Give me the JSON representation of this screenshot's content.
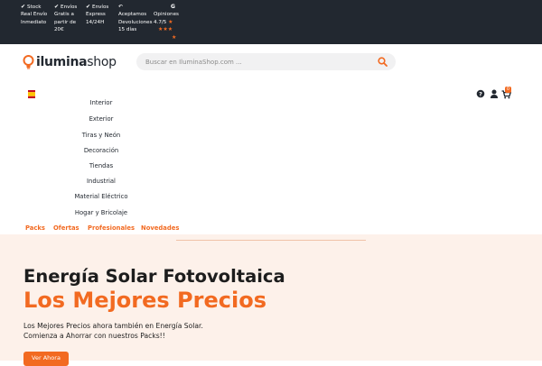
{
  "topbar": {
    "items": [
      {
        "icon": "check-icon",
        "lines": [
          "Stock",
          "Real Envío",
          "Inmediato"
        ]
      },
      {
        "icon": "check-icon",
        "lines": [
          "Envíos",
          "Gratis a",
          "partir de",
          "20€"
        ]
      },
      {
        "icon": "check-icon",
        "lines": [
          "Envíos",
          "Express",
          "14/24H"
        ]
      },
      {
        "icon": "return-icon",
        "lines": [
          "Aceptamos",
          "Devoluciones",
          "15 días"
        ]
      },
      {
        "icon": "google-icon",
        "lines": [
          "Opiniones",
          "4.7/5"
        ]
      }
    ],
    "rating_stars": 5
  },
  "header": {
    "brand_bold": "ilumina",
    "brand_regular": "shop",
    "search_placeholder": "Buscar en IluminaShop.com ...",
    "cart_count": "0"
  },
  "menu": {
    "items": [
      "Interior",
      "Exterior",
      "Tiras y Neón",
      "Decoración",
      "Tiendas",
      "Industrial",
      "Material Eléctrico",
      "Hogar y Bricolaje"
    ]
  },
  "subnav": {
    "items": [
      "Packs",
      "Ofertas",
      "Profesionales",
      "Novedades"
    ]
  },
  "hero": {
    "title": "Energía Solar Fotovoltaica",
    "subtitle": "Los Mejores Precios",
    "line1": "Los Mejores Precios ahora también en Energía Solar.",
    "line2": "Comienza a Ahorrar con nuestros Packs!!",
    "cta": "Ver Ahora"
  },
  "colors": {
    "topbar_bg": "#222830",
    "accent": "#f26a21",
    "hero_bg": "#fdf1ea"
  }
}
